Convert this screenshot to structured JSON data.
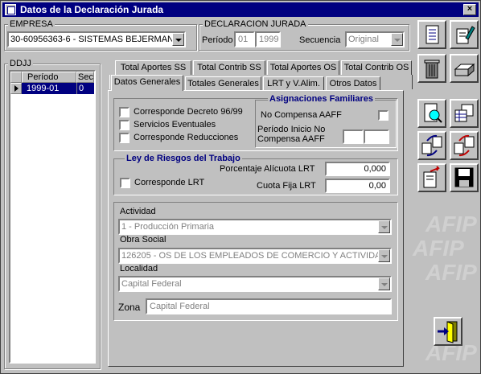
{
  "window": {
    "title": "Datos de la Declaración Jurada",
    "close": "×"
  },
  "empresa": {
    "label": "EMPRESA",
    "value": "30-60956363-6 - SISTEMAS BEJERMAN"
  },
  "ddjj_header": {
    "label": "DECLARACION JURADA",
    "periodo_label": "Período",
    "periodo_month": "01",
    "periodo_year": "1999",
    "secuencia_label": "Secuencia",
    "secuencia_value": "Original"
  },
  "ddjj_list": {
    "label": "DDJJ",
    "columns": [
      "Período",
      "Sec"
    ],
    "rows": [
      {
        "periodo": "1999-01",
        "sec": "0"
      }
    ]
  },
  "tabs_top": [
    "Total Aportes SS",
    "Total Contrib SS",
    "Total Aportes OS",
    "Total Contrib OS"
  ],
  "tabs_bottom": [
    "Datos Generales",
    "Totales Generales",
    "LRT y V.Alim.",
    "Otros Datos"
  ],
  "datos_generales": {
    "checks": [
      "Corresponde Decreto 96/99",
      "Servicios Eventuales",
      "Corresponde Reducciones"
    ],
    "asignaciones": {
      "title": "Asignaciones Familiares",
      "no_compensa": "No Compensa AAFF",
      "periodo_inicio": "Período Inicio No Compensa AAFF",
      "periodo_inicio_l1": "Período Inicio No",
      "periodo_inicio_l2": "Compensa AAFF"
    },
    "lrt": {
      "title": "Ley de Riesgos del Trabajo",
      "corresponde": "Corresponde LRT",
      "porcentaje_label": "Porcentaje Alícuota  LRT",
      "porcentaje_value": "0,000",
      "cuota_label": "Cuota Fija LRT",
      "cuota_value": "0,00"
    },
    "actividad_label": "Actividad",
    "actividad_value": "1 - Producción Primaria",
    "obra_social_label": "Obra Social",
    "obra_social_value": "126205 - OS  DE LOS EMPLEADOS DE COMERCIO Y ACTIVIDA",
    "localidad_label": "Localidad",
    "localidad_value": "Capital Federal",
    "zona_label": "Zona",
    "zona_value": "Capital Federal"
  },
  "watermark": "AFIP",
  "toolbar_icons": [
    "document-icon",
    "edit-document-icon",
    "trash-icon",
    "print-icon",
    "search-document-icon",
    "grid-icon",
    "refresh-icon",
    "exchange-icon",
    "export-icon",
    "save-icon",
    "exit-icon"
  ]
}
